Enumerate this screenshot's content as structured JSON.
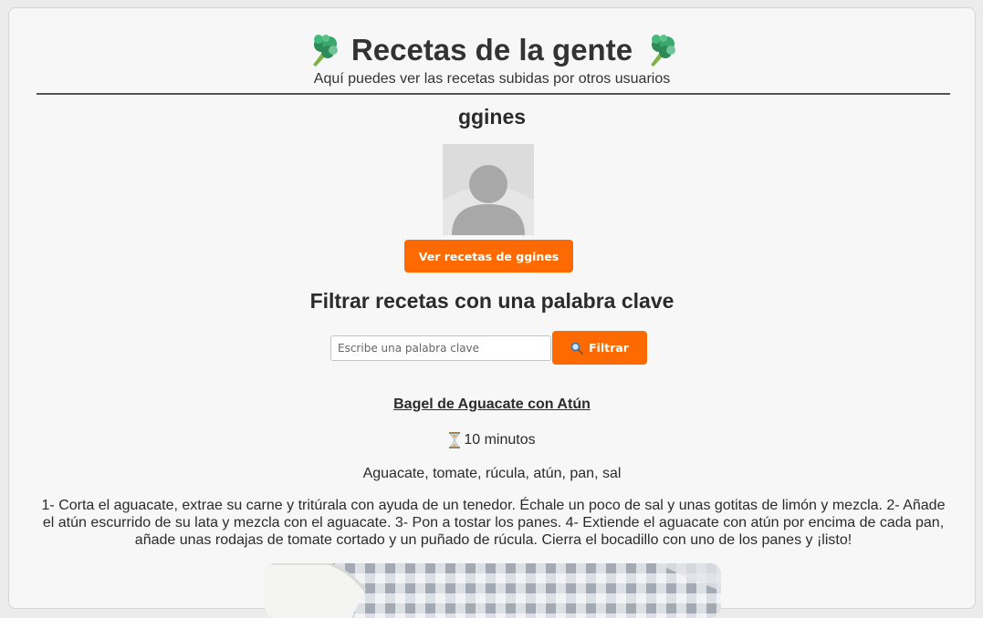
{
  "header": {
    "title": "Recetas de la gente",
    "subtitle": "Aquí puedes ver las recetas subidas por otros usuarios",
    "icon": "broccoli-icon"
  },
  "profile": {
    "username": "ggines",
    "avatar_icon": "user-avatar-placeholder",
    "view_button_label": "Ver recetas de ggines"
  },
  "filter": {
    "title": "Filtrar recetas con una palabra clave",
    "placeholder": "Escribe una palabra clave",
    "value": "",
    "button_label": "Filtrar",
    "button_icon": "magnifier-icon"
  },
  "recipe": {
    "title": "Bagel de Aguacate con Atún",
    "time_icon": "hourglass-icon",
    "time": "10 minutos",
    "ingredients": "Aguacate, tomate, rúcula, atún, pan, sal",
    "steps": "1- Corta el aguacate, extrae su carne y tritúrala con ayuda de un tenedor. Échale un poco de sal y unas gotitas de limón y mezcla. 2- Añade el atún escurrido de su lata y mezcla con el aguacate. 3- Pon a tostar los panes. 4- Extiende el aguacate con atún por encima de cada pan, añade unas rodajas de tomate cortado y un puñado de rúcula. Cierra el bocadillo con uno de los panes y ¡listo!"
  },
  "colors": {
    "accent": "#ff6a00",
    "background": "#f7f7f7",
    "text": "#2b2b2b"
  }
}
